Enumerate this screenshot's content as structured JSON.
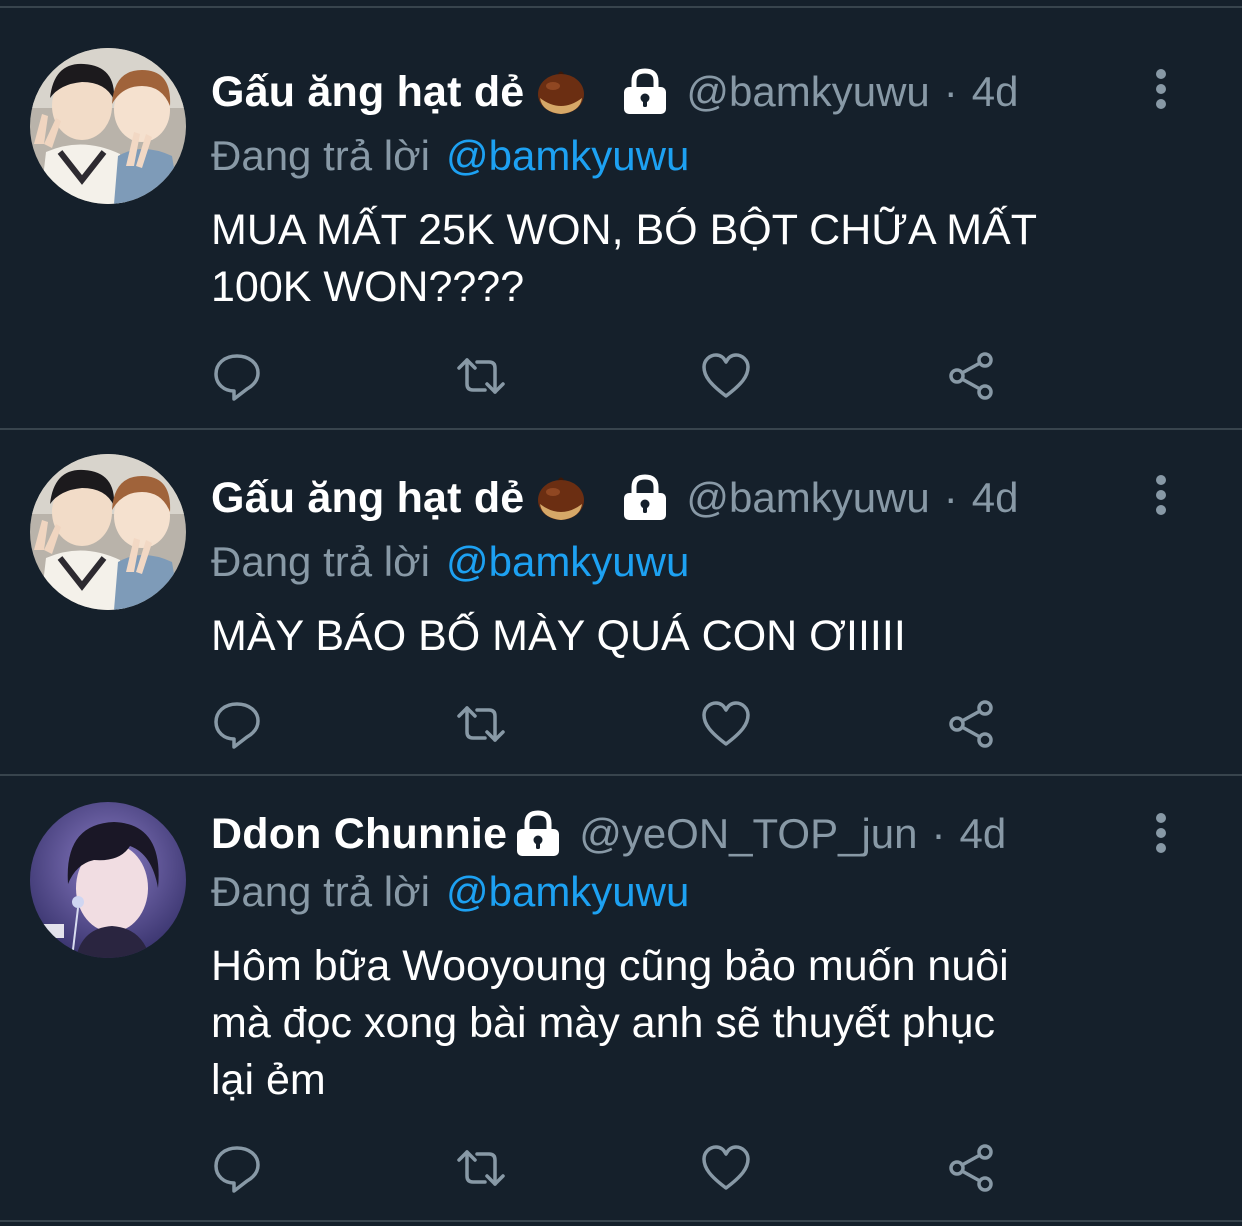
{
  "colors": {
    "background": "#15202b",
    "divider": "#38444d",
    "text_primary": "#ffffff",
    "text_secondary": "#8899a6",
    "accent": "#1da1f2"
  },
  "tweets": [
    {
      "display_name": "Gấu ăng hạt dẻ",
      "name_emoji": "chestnut-emoji",
      "locked": true,
      "handle": "@bamkyuwu",
      "separator": "·",
      "time": "4d",
      "reply_prefix": "Đang trả lời",
      "reply_handle": "@bamkyuwu",
      "text": "MUA MẤT 25K WON, BÓ BỘT CHỮA MẤT\n100K WON????",
      "avatar": "avatar-two-people",
      "actions": [
        "reply-icon",
        "retweet-icon",
        "like-icon",
        "share-icon"
      ]
    },
    {
      "display_name": "Gấu ăng hạt dẻ",
      "name_emoji": "chestnut-emoji",
      "locked": true,
      "handle": "@bamkyuwu",
      "separator": "·",
      "time": "4d",
      "reply_prefix": "Đang trả lời",
      "reply_handle": "@bamkyuwu",
      "text": "MÀY BÁO BỐ MÀY QUÁ CON ƠIIIII",
      "avatar": "avatar-two-people",
      "actions": [
        "reply-icon",
        "retweet-icon",
        "like-icon",
        "share-icon"
      ]
    },
    {
      "display_name": "Ddon Chunnie",
      "locked": true,
      "handle": "@yeON_TOP_jun",
      "separator": "·",
      "time": "4d",
      "reply_prefix": "Đang trả lời",
      "reply_handle": "@bamkyuwu",
      "text": "Hôm bữa Wooyoung cũng bảo muốn nuôi\nmà đọc xong bài mày anh sẽ thuyết phục\nlại ẻm",
      "avatar": "avatar-single-person",
      "actions": [
        "reply-icon",
        "retweet-icon",
        "like-icon",
        "share-icon"
      ]
    }
  ]
}
